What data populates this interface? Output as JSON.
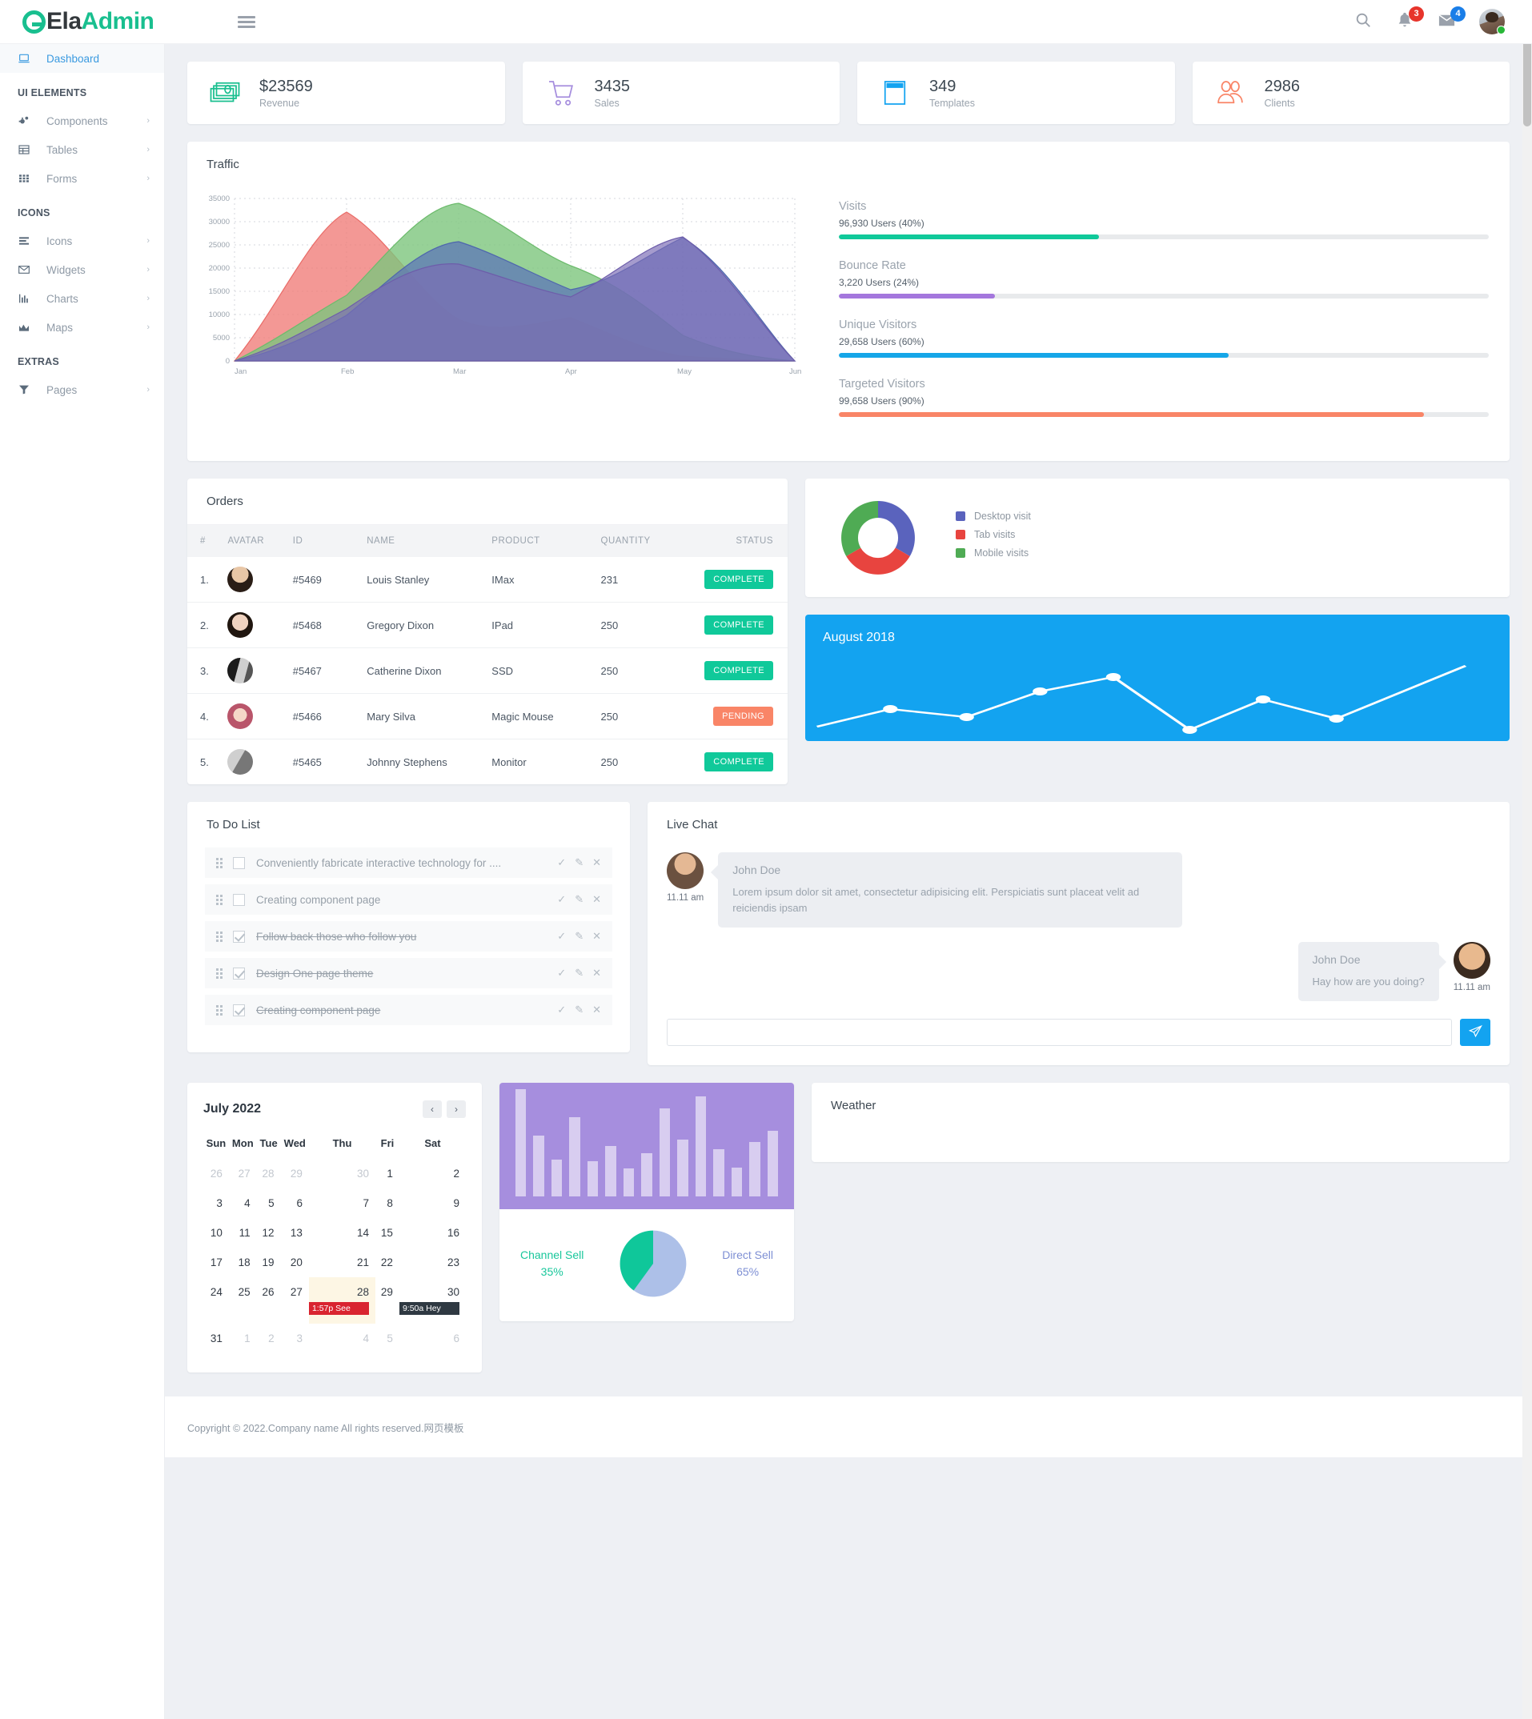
{
  "brand": {
    "part1": "Ela",
    "part2": "Admin"
  },
  "header": {
    "search_icon": "search-icon",
    "notifications_badge": "3",
    "messages_badge": "4"
  },
  "sidebar": {
    "dashboard": {
      "label": "Dashboard",
      "icon": "laptop-icon"
    },
    "sections": [
      {
        "title": "UI ELEMENTS",
        "items": [
          {
            "label": "Components",
            "icon": "cogs-icon",
            "chevron": "›"
          },
          {
            "label": "Tables",
            "icon": "table-icon",
            "chevron": "›"
          },
          {
            "label": "Forms",
            "icon": "grid-icon",
            "chevron": "›"
          }
        ]
      },
      {
        "title": "ICONS",
        "items": [
          {
            "label": "Icons",
            "icon": "list-icon",
            "chevron": "›"
          },
          {
            "label": "Widgets",
            "icon": "envelope-icon",
            "chevron": "›"
          },
          {
            "label": "Charts",
            "icon": "bar-chart-icon",
            "chevron": "›"
          },
          {
            "label": "Maps",
            "icon": "map-icon",
            "chevron": "›"
          }
        ]
      },
      {
        "title": "EXTRAS",
        "items": [
          {
            "label": "Pages",
            "icon": "filter-icon",
            "chevron": "›"
          }
        ]
      }
    ]
  },
  "stats": [
    {
      "value": "$23569",
      "label": "Revenue",
      "icon": "money-icon",
      "color": "#19bf8f"
    },
    {
      "value": "3435",
      "label": "Sales",
      "icon": "cart-icon",
      "color": "#a68ede"
    },
    {
      "value": "349",
      "label": "Templates",
      "icon": "window-icon",
      "color": "#13a3f0"
    },
    {
      "value": "2986",
      "label": "Clients",
      "icon": "users-icon",
      "color": "#f98567"
    }
  ],
  "traffic": {
    "title": "Traffic",
    "stats": [
      {
        "title": "Visits",
        "sub": "96,930 Users (40%)",
        "percent": 40,
        "color": "#10c99a"
      },
      {
        "title": "Bounce Rate",
        "sub": "3,220 Users (24%)",
        "percent": 24,
        "color": "#a477dd"
      },
      {
        "title": "Unique Visitors",
        "sub": "29,658 Users (60%)",
        "percent": 60,
        "color": "#15a6e8"
      },
      {
        "title": "Targeted Visitors",
        "sub": "99,658 Users (90%)",
        "percent": 90,
        "color": "#f98567"
      }
    ]
  },
  "orders": {
    "title": "Orders",
    "columns": [
      "#",
      "AVATAR",
      "ID",
      "NAME",
      "PRODUCT",
      "QUANTITY",
      "STATUS"
    ],
    "rows": [
      {
        "no": "1.",
        "id": "#5469",
        "name": "Louis Stanley",
        "product": "IMax",
        "quantity": "231",
        "status": "COMPLETE",
        "status_type": "complete"
      },
      {
        "no": "2.",
        "id": "#5468",
        "name": "Gregory Dixon",
        "product": "IPad",
        "quantity": "250",
        "status": "COMPLETE",
        "status_type": "complete"
      },
      {
        "no": "3.",
        "id": "#5467",
        "name": "Catherine Dixon",
        "product": "SSD",
        "quantity": "250",
        "status": "COMPLETE",
        "status_type": "complete"
      },
      {
        "no": "4.",
        "id": "#5466",
        "name": "Mary Silva",
        "product": "Magic Mouse",
        "quantity": "250",
        "status": "PENDING",
        "status_type": "pending"
      },
      {
        "no": "5.",
        "id": "#5465",
        "name": "Johnny Stephens",
        "product": "Monitor",
        "quantity": "250",
        "status": "COMPLETE",
        "status_type": "complete"
      }
    ]
  },
  "blue_card": {
    "title": "August 2018"
  },
  "todo": {
    "title": "To Do List",
    "items": [
      {
        "text": "Conveniently fabricate interactive technology for ....",
        "done": false
      },
      {
        "text": "Creating component page",
        "done": false
      },
      {
        "text": "Follow back those who follow you",
        "done": true
      },
      {
        "text": "Design One page theme",
        "done": true
      },
      {
        "text": "Creating component page",
        "done": true
      }
    ],
    "action_icons": [
      "check-icon",
      "pencil-icon",
      "close-icon"
    ]
  },
  "chat": {
    "title": "Live Chat",
    "messages": [
      {
        "side": "left",
        "who": "John Doe",
        "body": "Lorem ipsum dolor sit amet, consectetur adipisicing elit. Perspiciatis sunt placeat velit ad reiciendis ipsam",
        "time": "11.11 am"
      },
      {
        "side": "right",
        "who": "John Doe",
        "body": "Hay how are you doing?",
        "time": "11.11 am"
      }
    ],
    "input_value": "",
    "input_placeholder": "",
    "send_icon": "paper-plane-icon"
  },
  "calendar": {
    "title": "July 2022",
    "prev": "‹",
    "next": "›",
    "day_names": [
      "Sun",
      "Mon",
      "Tue",
      "Wed",
      "Thu",
      "Fri",
      "Sat"
    ],
    "weeks": [
      [
        {
          "d": "26",
          "mute": true
        },
        {
          "d": "27",
          "mute": true
        },
        {
          "d": "28",
          "mute": true
        },
        {
          "d": "29",
          "mute": true
        },
        {
          "d": "30",
          "mute": true
        },
        {
          "d": "1"
        },
        {
          "d": "2"
        }
      ],
      [
        {
          "d": "3"
        },
        {
          "d": "4"
        },
        {
          "d": "5"
        },
        {
          "d": "6"
        },
        {
          "d": "7"
        },
        {
          "d": "8"
        },
        {
          "d": "9"
        }
      ],
      [
        {
          "d": "10"
        },
        {
          "d": "11"
        },
        {
          "d": "12"
        },
        {
          "d": "13"
        },
        {
          "d": "14"
        },
        {
          "d": "15"
        },
        {
          "d": "16"
        }
      ],
      [
        {
          "d": "17"
        },
        {
          "d": "18"
        },
        {
          "d": "19"
        },
        {
          "d": "20"
        },
        {
          "d": "21"
        },
        {
          "d": "22"
        },
        {
          "d": "23"
        }
      ],
      [
        {
          "d": "24"
        },
        {
          "d": "25"
        },
        {
          "d": "26"
        },
        {
          "d": "27"
        },
        {
          "d": "28",
          "hl": true,
          "event": "1:57p See",
          "event_style": "red"
        },
        {
          "d": "29"
        },
        {
          "d": "30",
          "event": "9:50a Hey",
          "event_style": "dark"
        }
      ],
      [
        {
          "d": "31"
        },
        {
          "d": "1",
          "mute": true
        },
        {
          "d": "2",
          "mute": true
        },
        {
          "d": "3",
          "mute": true
        },
        {
          "d": "4",
          "mute": true
        },
        {
          "d": "5",
          "mute": true
        },
        {
          "d": "6",
          "mute": true
        }
      ]
    ]
  },
  "sell": {
    "channel_label": "Channel Sell",
    "channel_value": "35%",
    "direct_label": "Direct Sell",
    "direct_value": "65%"
  },
  "weather": {
    "title": "Weather"
  },
  "footer": {
    "text": "Copyright © 2022.Company name All rights reserved.网页模板"
  },
  "chart_data": [
    {
      "type": "area",
      "name": "traffic",
      "title": "Traffic",
      "categories": [
        "Jan",
        "Feb",
        "Mar",
        "Apr",
        "May",
        "Jun"
      ],
      "ylim": [
        0,
        35000
      ],
      "yticks": [
        0,
        5000,
        10000,
        15000,
        20000,
        25000,
        30000,
        35000
      ],
      "grid": true,
      "legend": "none",
      "series": [
        {
          "name": "series-red",
          "color": "#ef7b77",
          "values": [
            0,
            32000,
            12000,
            6500,
            4000,
            1000
          ]
        },
        {
          "name": "series-green",
          "color": "#7dc67d",
          "values": [
            0,
            14000,
            33500,
            20500,
            13000,
            2000
          ]
        },
        {
          "name": "series-blue",
          "color": "#5a73b8",
          "values": [
            0,
            9000,
            23500,
            18500,
            24500,
            1500
          ]
        },
        {
          "name": "series-purple",
          "color": "#7b6bb5",
          "values": [
            0,
            13000,
            19000,
            15500,
            28500,
            1000
          ]
        }
      ]
    },
    {
      "type": "pie",
      "name": "device-visits-donut",
      "labels": [
        "Desktop visit",
        "Tab visits",
        "Mobile visits"
      ],
      "values": [
        33,
        33,
        34
      ],
      "colors": [
        "#5a63bd",
        "#e8443f",
        "#4fab54"
      ],
      "donut": true,
      "legend": "right"
    },
    {
      "type": "line",
      "name": "august-2018-line",
      "title": "August 2018",
      "values": [
        8,
        30,
        18,
        48,
        62,
        2,
        40,
        14,
        80
      ],
      "ylim": [
        0,
        100
      ],
      "color": "#ffffff",
      "grid": false,
      "legend": "none"
    },
    {
      "type": "bar",
      "name": "sell-bars",
      "values": [
        95,
        54,
        33,
        70,
        31,
        45,
        25,
        38,
        78,
        50,
        88,
        42,
        26,
        48,
        58
      ],
      "ylim": [
        0,
        100
      ],
      "color": "#d8cdf0",
      "grid": false,
      "legend": "none"
    },
    {
      "type": "pie",
      "name": "sell-split-pie",
      "labels": [
        "Channel Sell",
        "Direct Sell"
      ],
      "values": [
        35,
        65
      ],
      "colors": [
        "#0fc79a",
        "#adc0e8"
      ],
      "donut": false,
      "legend": "sides"
    }
  ]
}
